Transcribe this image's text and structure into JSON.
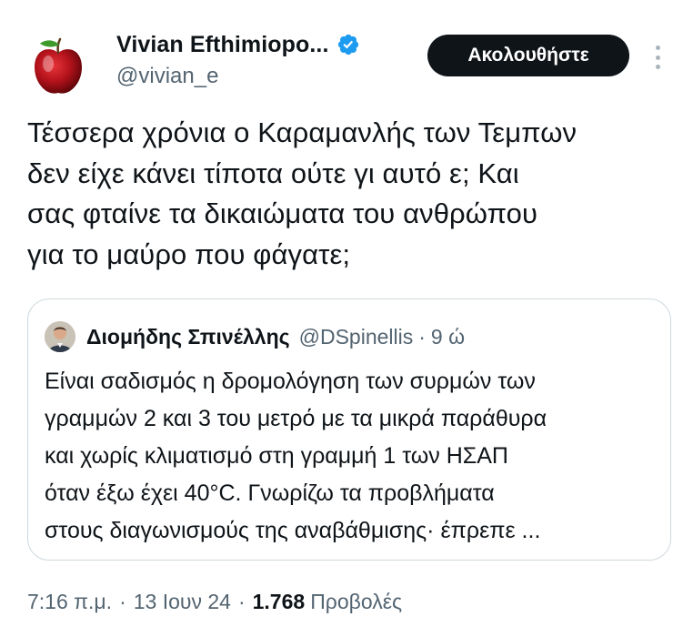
{
  "author": {
    "display_name": "Vivian Efthimiopo...",
    "handle": "@vivian_e",
    "verified": true,
    "avatar_icon": "red-apple-icon"
  },
  "actions": {
    "follow_label": "Ακολουθήστε",
    "more_icon": "more-vertical-icon"
  },
  "tweet": {
    "text_lines": [
      "Τέσσερα χρόνια ο Καραμανλής των Τεμπων",
      "δεν είχε κάνει τίποτα ούτε γι αυτό ε; Και",
      "σας φταίνε τα δικαιώματα του ανθρώπου",
      "για το μαύρο που φάγατε;"
    ]
  },
  "quoted": {
    "display_name": "Διομήδης Σπινέλλης",
    "handle": "@DSpinellis",
    "separator": "·",
    "time": "9 ώ",
    "text_lines": [
      "Είναι σαδισμός η δρομολόγηση των συρμών των",
      "γραμμών 2 και 3 του μετρό με τα μικρά παράθυρα",
      "και χωρίς κλιματισμό στη γραμμή 1 των ΗΣΑΠ",
      "όταν έξω έχει 40°C. Γνωρίζω τα προβλήματα",
      "στους διαγωνισμούς της αναβάθμισης· έπρεπε ..."
    ]
  },
  "meta": {
    "time": "7:16 π.μ.",
    "date": "13 Ιουν 24",
    "separator": "·",
    "views_count": "1.768",
    "views_label": "Προβολές"
  },
  "colors": {
    "text_primary": "#0f1419",
    "text_secondary": "#536471",
    "verified_blue": "#1d9bf0",
    "border": "#cfd9de",
    "button_bg": "#0f1419"
  }
}
